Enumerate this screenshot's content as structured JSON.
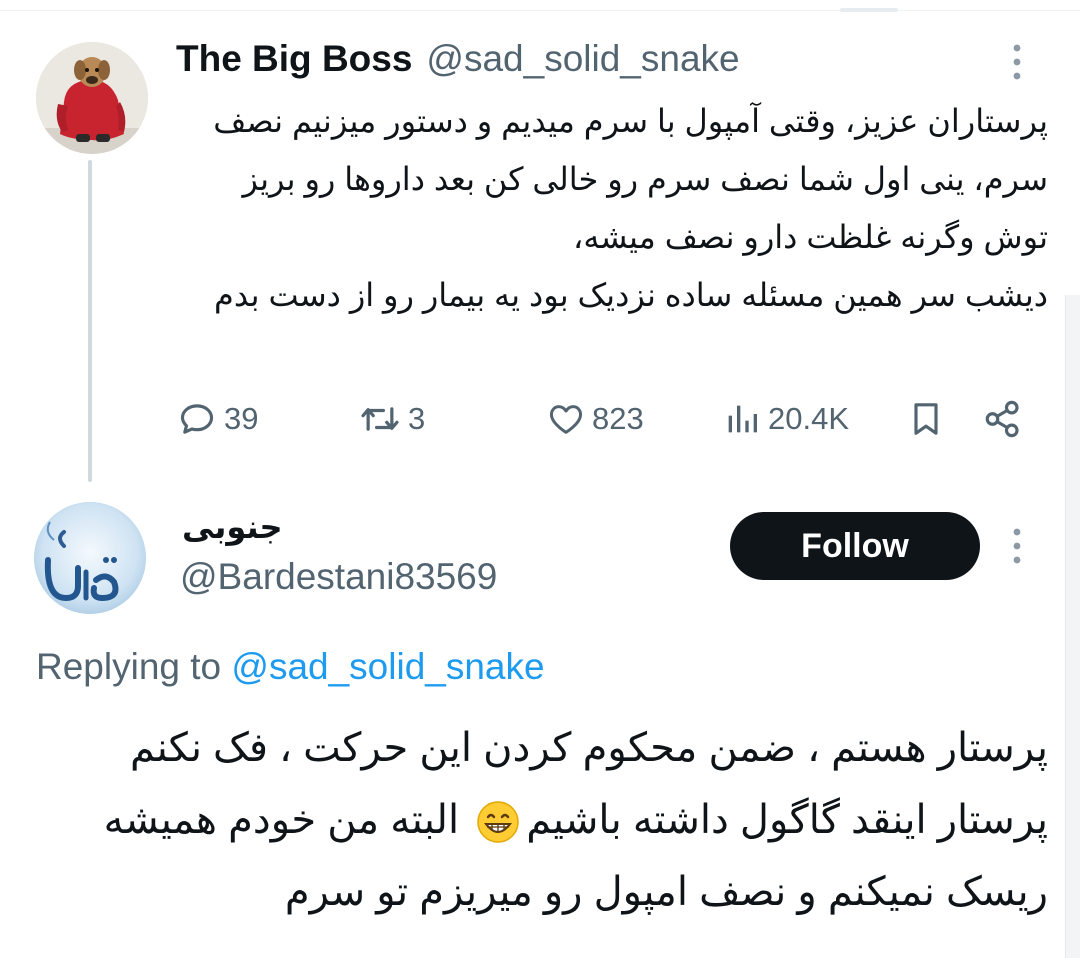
{
  "tweet": {
    "author_name": "The Big Boss",
    "author_handle": "@sad_solid_snake",
    "text": "پرستاران عزیز، وقتی آمپول با سرم میدیم و دستور میزنیم نصف سرم، ینی اول شما نصف سرم رو خالی کن بعد داروها رو بریز توش وگرنه غلظت دارو نصف میشه،\nدیشب سر همین مسئله ساده نزدیک بود یه بیمار رو از دست بدم",
    "replies": "39",
    "reposts": "3",
    "likes": "823",
    "views": "20.4K"
  },
  "reply": {
    "author_name": "جنوبی",
    "author_handle": "@Bardestani83569",
    "follow_label": "Follow",
    "replying_prefix": "Replying to",
    "replying_to": "@sad_solid_snake",
    "text_part1": "پرستار هستم ، ضمن محکوم کردن این حرکت ، فک نکنم پرستار اینقد گاگول داشته باشیم",
    "text_part2": " البته من خودم همیشه ریسک نمیکنم و نصف امپول رو میریزم تو سرم"
  },
  "icons": {
    "reply": "speech-bubble-icon",
    "repost": "repost-arrows-icon",
    "like": "heart-icon",
    "views": "bar-chart-icon",
    "bookmark": "bookmark-icon",
    "share": "share-icon",
    "more": "more-vertical-icon",
    "emoji": "grinning-face-emoji"
  },
  "colors": {
    "text": "#0f1419",
    "secondary": "#536471",
    "link": "#1d9bf0",
    "button_bg": "#0f1419",
    "thread_line": "#cfd9de"
  }
}
